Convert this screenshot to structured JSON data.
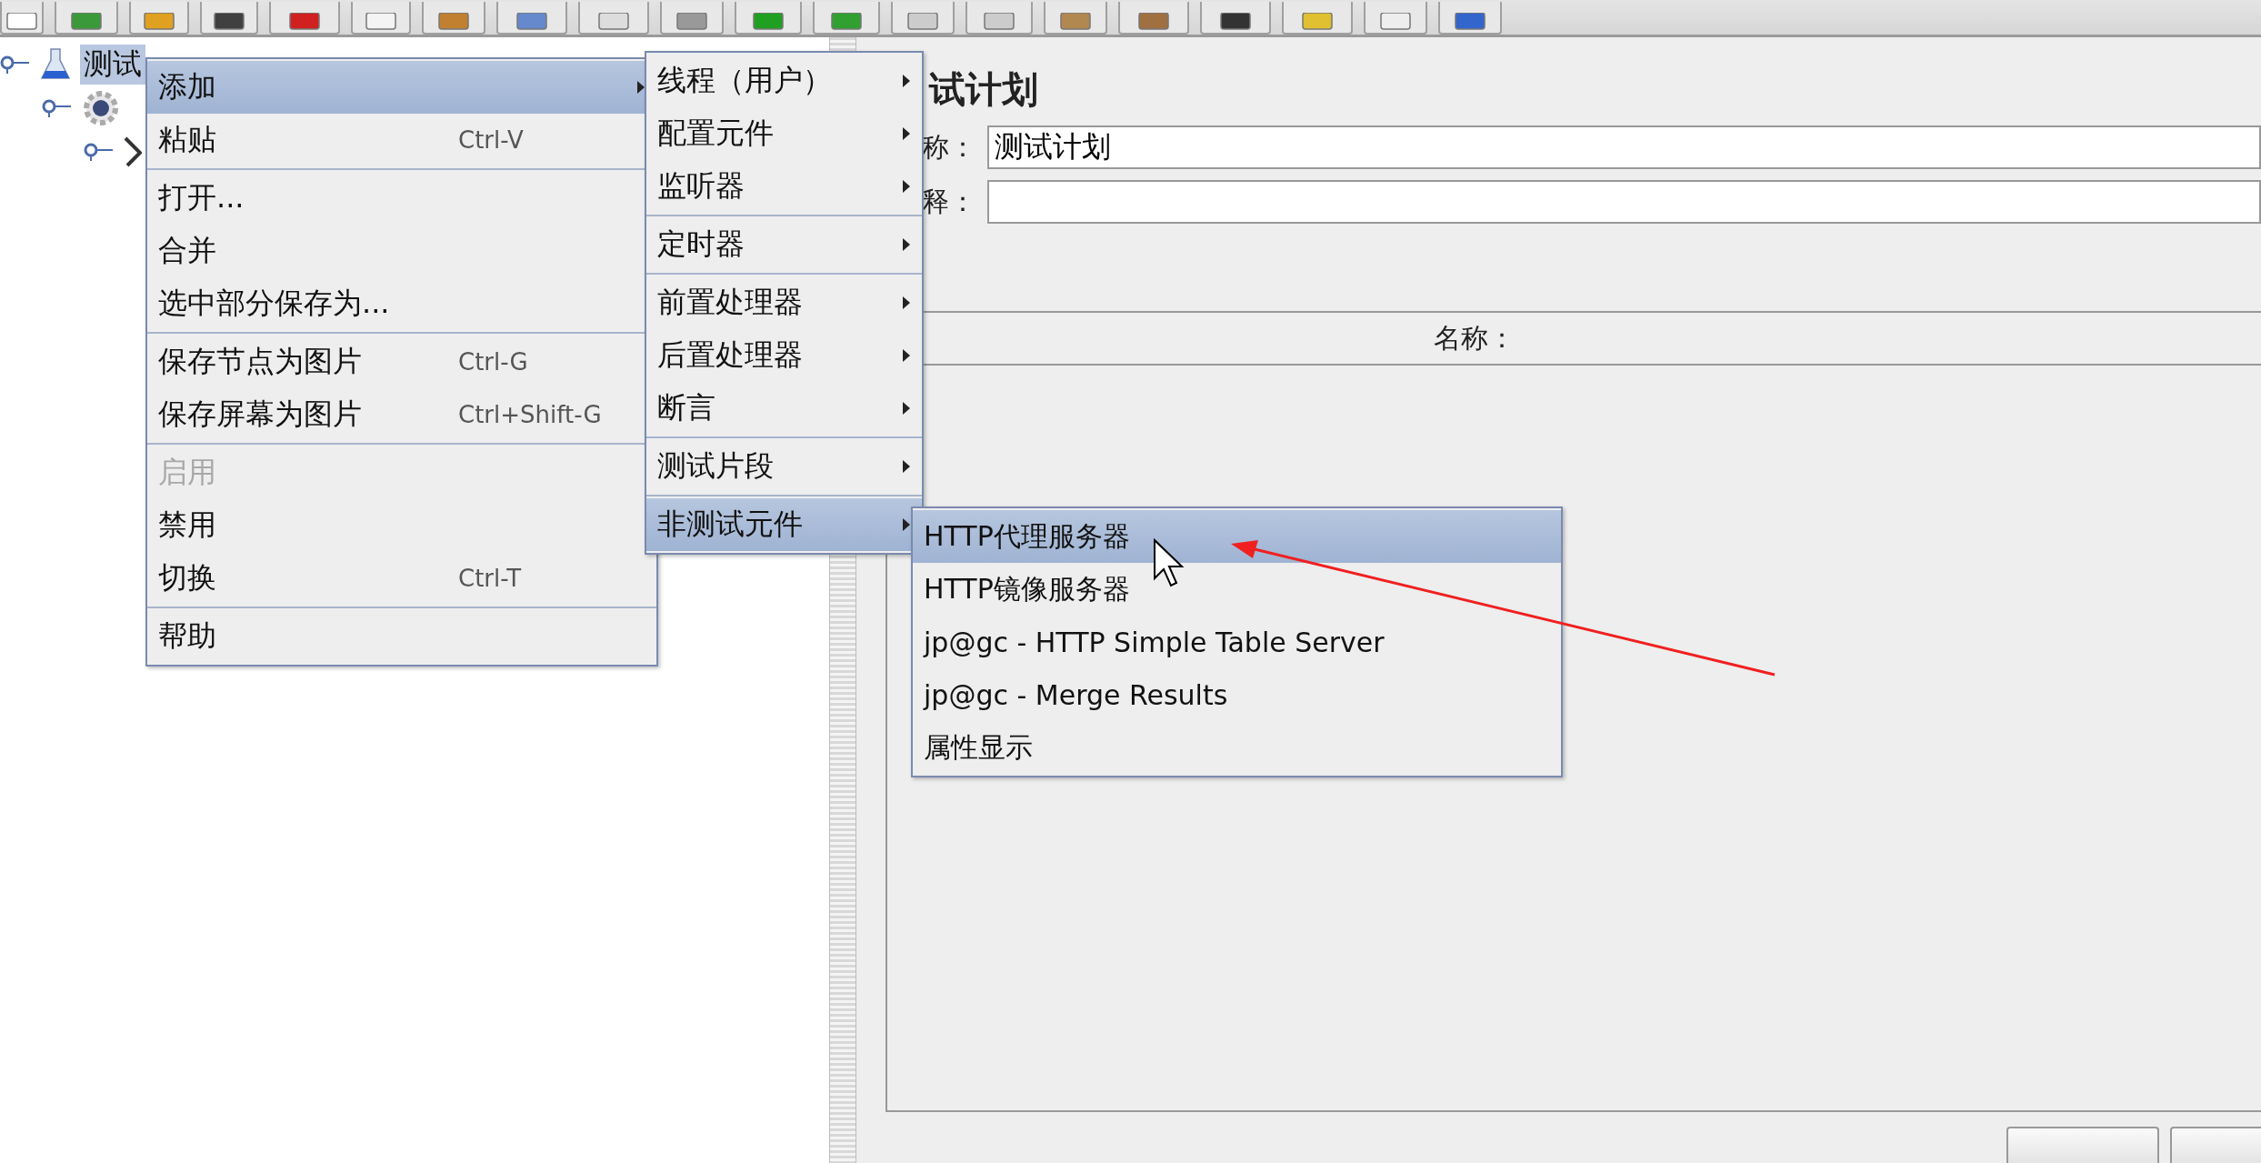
{
  "tree": {
    "items": [
      {
        "kind": "test-plan",
        "label": "测试",
        "selected": true,
        "children": [
          {
            "kind": "thread-group",
            "children": [
              {
                "kind": "sampler"
              }
            ]
          }
        ]
      }
    ]
  },
  "panel": {
    "title": "试计划",
    "fields": [
      {
        "label": "称：",
        "value": "测试计划"
      },
      {
        "label": "释："
      }
    ],
    "table": {
      "columns": [
        "名称："
      ]
    }
  },
  "context_menu": {
    "items": [
      {
        "kind": "item",
        "label": "添加",
        "submenu": true,
        "selected": true,
        "disabled": false
      },
      {
        "kind": "item",
        "label": "粘贴",
        "shortcut": "Ctrl-V",
        "submenu": false,
        "selected": false,
        "disabled": false
      },
      {
        "kind": "separator"
      },
      {
        "kind": "item",
        "label": "打开...",
        "submenu": false,
        "selected": false,
        "disabled": false
      },
      {
        "kind": "item",
        "label": "合并",
        "submenu": false,
        "selected": false,
        "disabled": false
      },
      {
        "kind": "item",
        "label": "选中部分保存为...",
        "submenu": false,
        "selected": false,
        "disabled": false
      },
      {
        "kind": "separator"
      },
      {
        "kind": "item",
        "label": "保存节点为图片",
        "shortcut": "Ctrl-G",
        "submenu": false,
        "selected": false,
        "disabled": false
      },
      {
        "kind": "item",
        "label": "保存屏幕为图片",
        "shortcut": "Ctrl+Shift-G",
        "submenu": false,
        "selected": false,
        "disabled": false
      },
      {
        "kind": "separator"
      },
      {
        "kind": "item",
        "label": "启用",
        "submenu": false,
        "selected": false,
        "disabled": true
      },
      {
        "kind": "item",
        "label": "禁用",
        "submenu": false,
        "selected": false,
        "disabled": false
      },
      {
        "kind": "item",
        "label": "切换",
        "shortcut": "Ctrl-T",
        "submenu": false,
        "selected": false,
        "disabled": false
      },
      {
        "kind": "separator"
      },
      {
        "kind": "item",
        "label": "帮助",
        "submenu": false,
        "selected": false,
        "disabled": false
      }
    ]
  },
  "submenu": {
    "items": [
      {
        "kind": "item",
        "label": "线程（用户）",
        "submenu": true,
        "selected": false,
        "disabled": false
      },
      {
        "kind": "item",
        "label": "配置元件",
        "submenu": true,
        "selected": false,
        "disabled": false
      },
      {
        "kind": "item",
        "label": "监听器",
        "submenu": true,
        "selected": false,
        "disabled": false
      },
      {
        "kind": "separator"
      },
      {
        "kind": "item",
        "label": "定时器",
        "submenu": true,
        "selected": false,
        "disabled": false
      },
      {
        "kind": "separator"
      },
      {
        "kind": "item",
        "label": "前置处理器",
        "submenu": true,
        "selected": false,
        "disabled": false
      },
      {
        "kind": "item",
        "label": "后置处理器",
        "submenu": true,
        "selected": false,
        "disabled": false
      },
      {
        "kind": "item",
        "label": "断言",
        "submenu": true,
        "selected": false,
        "disabled": false
      },
      {
        "kind": "separator"
      },
      {
        "kind": "item",
        "label": "测试片段",
        "submenu": true,
        "selected": false,
        "disabled": false
      },
      {
        "kind": "separator"
      },
      {
        "kind": "item",
        "label": "非测试元件",
        "submenu": true,
        "selected": true,
        "disabled": false
      }
    ]
  },
  "nested_submenu": {
    "items": [
      {
        "kind": "item",
        "label": "HTTP代理服务器",
        "submenu": false,
        "selected": true,
        "disabled": false
      },
      {
        "kind": "item",
        "label": "HTTP镜像服务器",
        "submenu": false,
        "selected": false,
        "disabled": false
      },
      {
        "kind": "item",
        "label": "jp@gc - HTTP Simple Table Server",
        "submenu": false,
        "selected": false,
        "disabled": false
      },
      {
        "kind": "item",
        "label": "jp@gc - Merge Results",
        "submenu": false,
        "selected": false,
        "disabled": false
      },
      {
        "kind": "item",
        "label": "属性显示",
        "submenu": false,
        "selected": false,
        "disabled": false
      }
    ]
  }
}
